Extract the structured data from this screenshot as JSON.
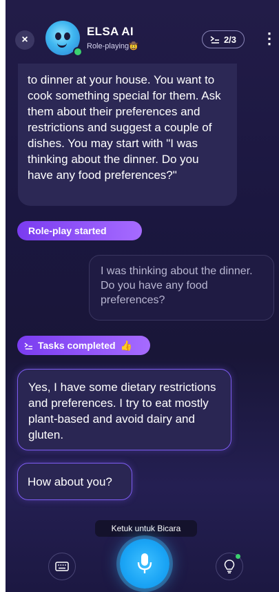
{
  "header": {
    "title": "ELSA AI",
    "subtitle": "Role-playing",
    "subtitle_emoji": "🤠",
    "progress": "2/3",
    "close_icon": "×",
    "more_icon": "⋮"
  },
  "messages": {
    "ai_instructions": "to dinner at your house. You want to cook something special for them. Ask them about their preferences and restrictions and suggest a couple of dishes. You may start with \"I was thinking about the dinner. Do you have any food preferences?\"",
    "roleplay_tag": "Role-play started",
    "user_message": "I was thinking about the dinner. Do you have any food preferences?",
    "tasks_tag": "Tasks completed",
    "tasks_emoji": "👍",
    "ai_reply_1": "Yes, I have some dietary restrictions and preferences. I try to eat mostly plant-based and avoid dairy and gluten.",
    "ai_reply_2": "How about you?"
  },
  "bottom": {
    "hint_text": "Ketuk untuk Bicara"
  },
  "colors": {
    "accent": "#7a3cf0",
    "mic": "#1aa4f5",
    "online": "#3bd16f"
  }
}
